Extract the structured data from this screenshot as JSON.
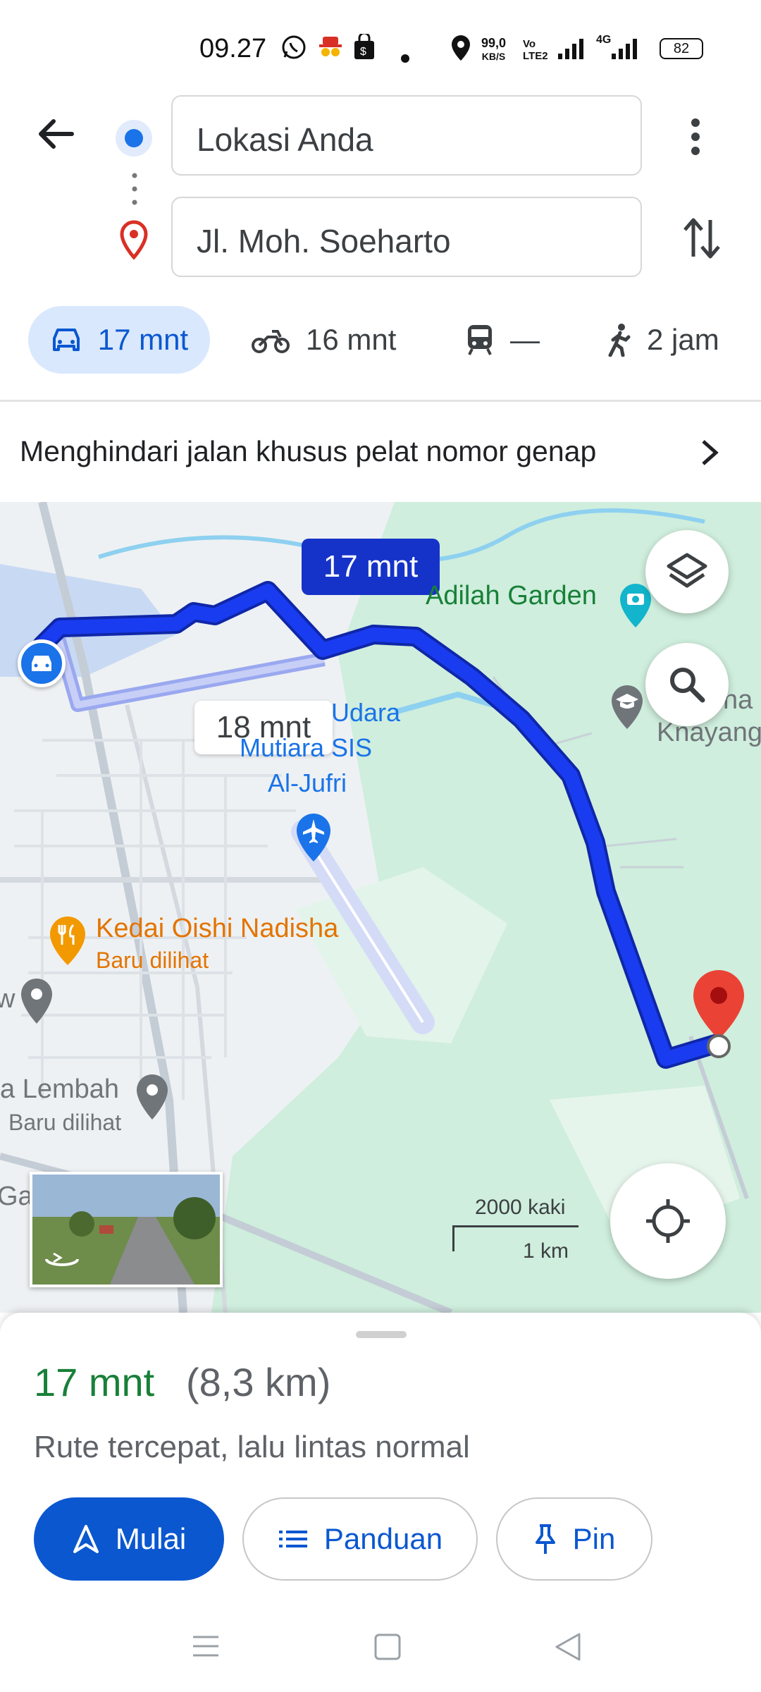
{
  "status_bar": {
    "time": "09.27",
    "net_speed": "99,0",
    "net_unit": "KB/S",
    "volte": "Vo LTE2",
    "network": "4G",
    "battery": "82",
    "icons": [
      "whatsapp-icon",
      "incognito-icon",
      "shopping-bag-icon",
      "dot-icon",
      "location-icon",
      "signal-icon"
    ]
  },
  "directions": {
    "origin": "Lokasi Anda",
    "destination": "Jl. Moh. Soeharto"
  },
  "modes": [
    {
      "name": "car",
      "label": "17 mnt"
    },
    {
      "name": "motorcycle",
      "label": "16 mnt"
    },
    {
      "name": "transit",
      "label": "—"
    },
    {
      "name": "walk",
      "label": "2 jam"
    }
  ],
  "banner": "Menghindari jalan khusus pelat nomor genap",
  "map": {
    "route_badge": "17 mnt",
    "alt_route_badge": "18 mnt",
    "labels": {
      "garden": "Adilah Garden",
      "airport_1": "Udara",
      "airport_2": "Mutiara SIS",
      "airport_3": "Al-Jufri",
      "school_1": "na",
      "school_2": "Knayang",
      "restaurant": "Kedai Oishi Nadisha",
      "restaurant_sub": "Baru dilihat",
      "lembah": "a Lembah",
      "lembah_sub": "Baru dilihat",
      "w": "w",
      "gac": "Gac"
    },
    "scale_ft": "2000 kaki",
    "scale_km": "1 km"
  },
  "summary": {
    "duration": "17 mnt",
    "distance": "(8,3 km)",
    "description": "Rute tercepat, lalu lintas normal"
  },
  "actions": {
    "start": "Mulai",
    "guide": "Panduan",
    "pin": "Pin"
  },
  "colors": {
    "route": "#1a3cf0",
    "accent": "#0b57d0",
    "duration_green": "#188038",
    "restaurant": "#e37400"
  }
}
